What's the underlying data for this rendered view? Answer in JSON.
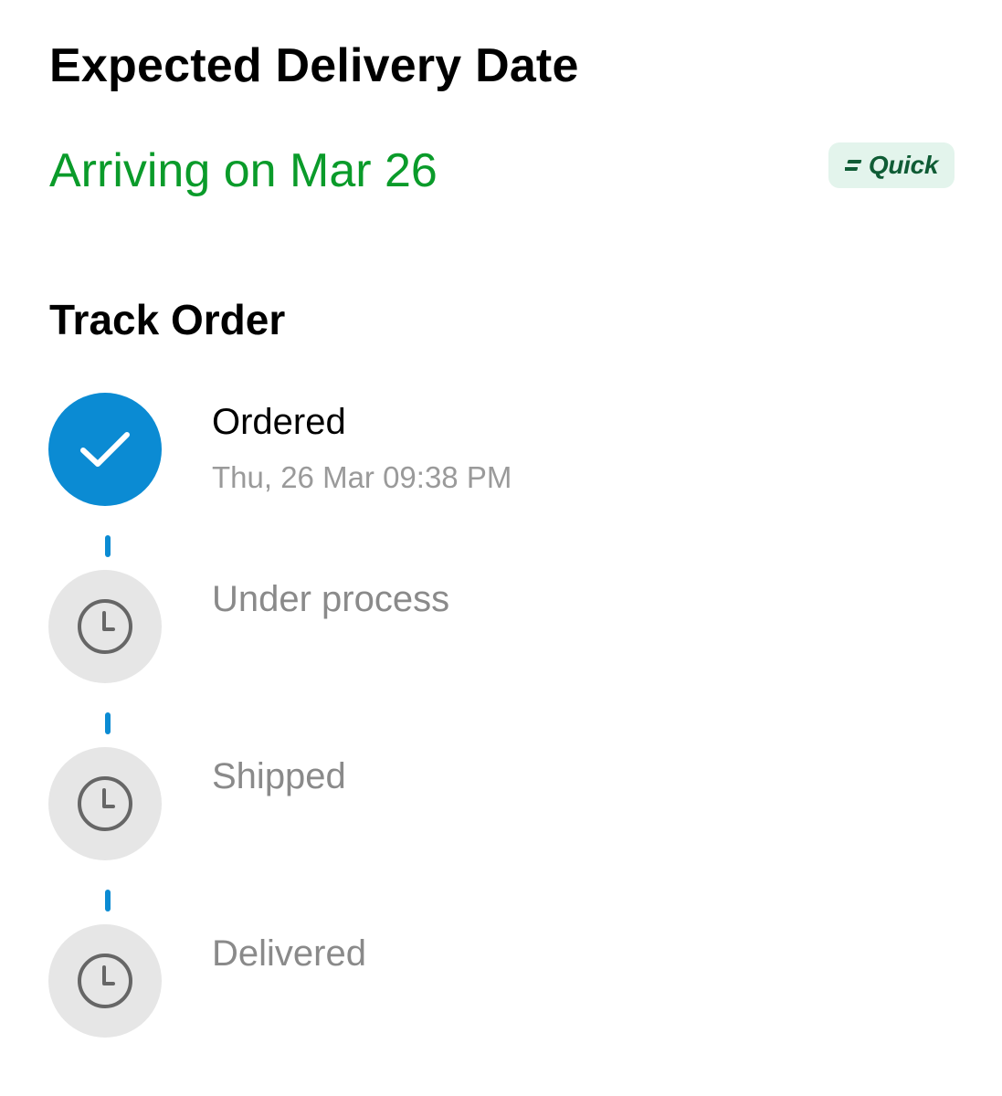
{
  "delivery": {
    "heading": "Expected Delivery Date",
    "arriving_text": "Arriving on Mar 26",
    "badge_label": "Quick",
    "arriving_color": "#0a9b2a"
  },
  "tracking": {
    "heading": "Track Order",
    "accent_color": "#0b8bd3",
    "steps": [
      {
        "label": "Ordered",
        "time": "Thu, 26 Mar 09:38 PM",
        "status": "completed",
        "icon": "check-icon"
      },
      {
        "label": "Under process",
        "status": "pending",
        "icon": "clock-icon"
      },
      {
        "label": "Shipped",
        "status": "pending",
        "icon": "clock-icon"
      },
      {
        "label": "Delivered",
        "status": "pending",
        "icon": "clock-icon"
      }
    ]
  }
}
